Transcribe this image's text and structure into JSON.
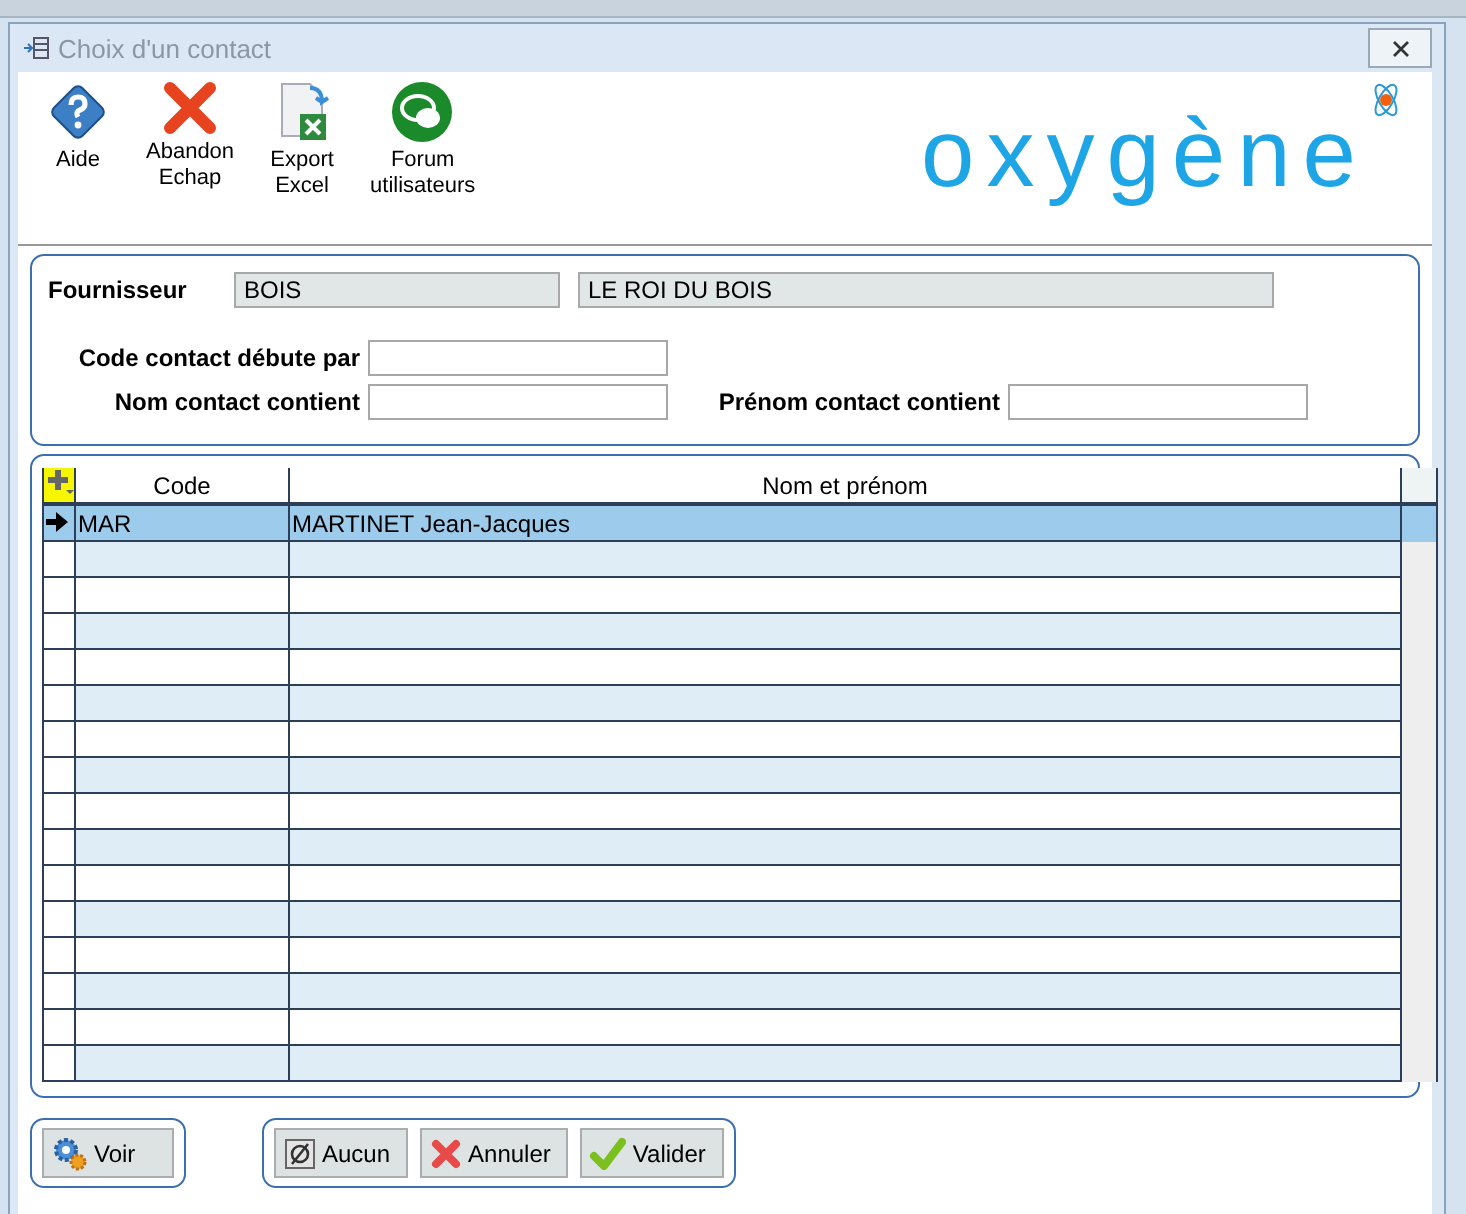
{
  "window": {
    "title": "Choix d'un contact"
  },
  "toolbar": [
    {
      "kind": "help",
      "lines": [
        "Aide"
      ]
    },
    {
      "kind": "cancel",
      "lines": [
        "Abandon",
        "Echap"
      ]
    },
    {
      "kind": "excel",
      "lines": [
        "Export",
        "Excel"
      ]
    },
    {
      "kind": "forum",
      "lines": [
        "Forum",
        "utilisateurs"
      ]
    }
  ],
  "logo": {
    "text": "oxygène"
  },
  "filters": {
    "supplier_label": "Fournisseur",
    "supplier_code": "BOIS",
    "supplier_name": "LE ROI DU BOIS",
    "code_label": "Code contact débute par",
    "name_label": "Nom contact contient",
    "firstname_label": "Prénom contact contient"
  },
  "table": {
    "columns": [
      "Code",
      "Nom et prénom"
    ],
    "rows": [
      {
        "code": "MAR",
        "name": "MARTINET Jean-Jacques",
        "selected": true
      }
    ]
  },
  "buttons_left": [
    {
      "kind": "view",
      "label": "Voir"
    }
  ],
  "buttons_right": [
    {
      "kind": "none",
      "label": "Aucun"
    },
    {
      "kind": "cancel",
      "label": "Annuler"
    },
    {
      "kind": "ok",
      "label": "Valider"
    }
  ]
}
